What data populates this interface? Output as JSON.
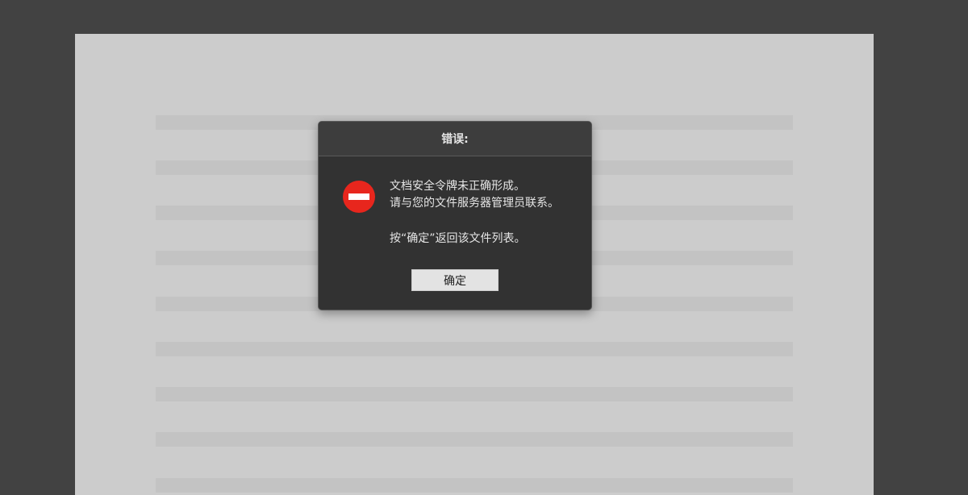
{
  "dialog": {
    "title": "错误:",
    "icon": "no-entry-icon",
    "icon_color": "#e8261d",
    "message_lines": [
      "文档安全令牌未正确形成。",
      "请与您的文件服务器管理员联系。"
    ],
    "instruction": "按“确定”返回该文件列表。",
    "ok_label": "确定"
  }
}
